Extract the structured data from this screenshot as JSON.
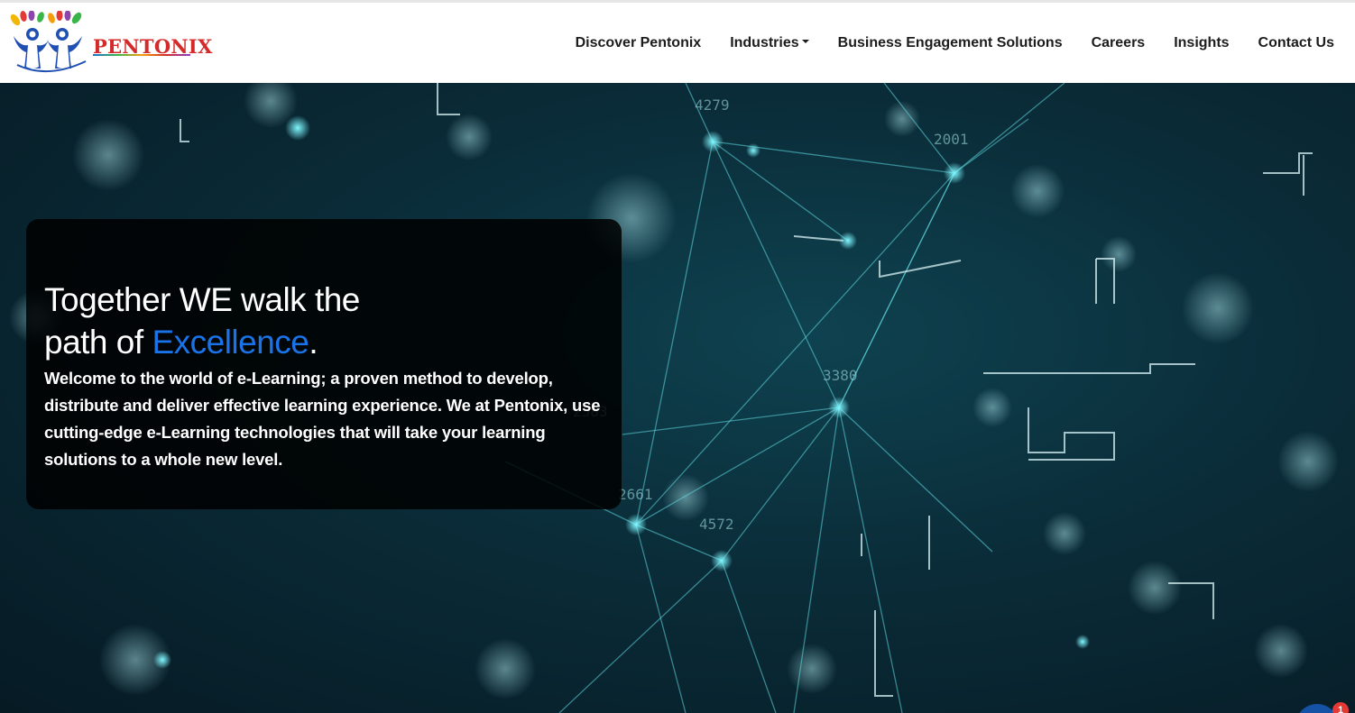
{
  "brand": {
    "name": "PENTONIX",
    "colors": {
      "brand_red": "#d42a2a",
      "figure_blue": "#1f4fb3",
      "accent_blue": "#1a73e8",
      "card_bg": "#000000"
    }
  },
  "nav": {
    "items": [
      {
        "label": "Discover Pentonix",
        "dropdown": false
      },
      {
        "label": "Industries",
        "dropdown": true
      },
      {
        "label": "Business Engagement Solutions",
        "dropdown": false
      },
      {
        "label": "Careers",
        "dropdown": false
      },
      {
        "label": "Insights",
        "dropdown": false
      },
      {
        "label": "Contact Us",
        "dropdown": false
      }
    ]
  },
  "hero": {
    "title_line1": "Together WE walk the",
    "title_line2_prefix": "path of ",
    "title_accent": "Excellence",
    "title_suffix": ".",
    "description": "Welcome to the world of e-Learning; a proven method to develop, distribute and deliver effective learning experience. We at Pentonix, use cutting-edge e-Learning technologies that will take your learning solutions to a whole new level."
  },
  "chat": {
    "badge_count": "1",
    "icon": "chat-icon"
  }
}
